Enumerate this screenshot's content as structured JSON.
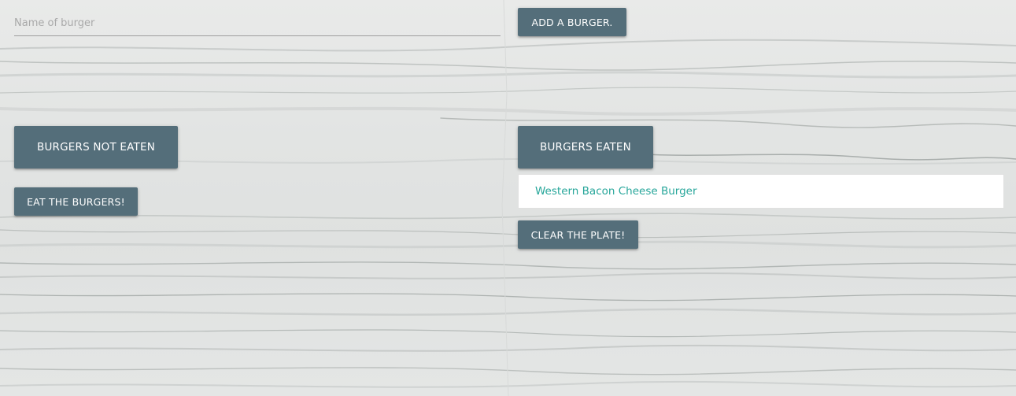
{
  "form": {
    "name_placeholder": "Name of burger",
    "name_value": "",
    "add_button_label": "ADD A BURGER."
  },
  "not_eaten": {
    "heading_label": "BURGERS NOT EATEN",
    "eat_button_label": "EAT THE BURGERS!",
    "items": []
  },
  "eaten": {
    "heading_label": "BURGERS EATEN",
    "items": [
      "Western Bacon Cheese Burger"
    ],
    "clear_button_label": "CLEAR THE PLATE!"
  },
  "colors": {
    "button": "#546e7a",
    "button_text": "#ffffff",
    "list_text": "#26a69a",
    "background": "#e6e7e6"
  }
}
